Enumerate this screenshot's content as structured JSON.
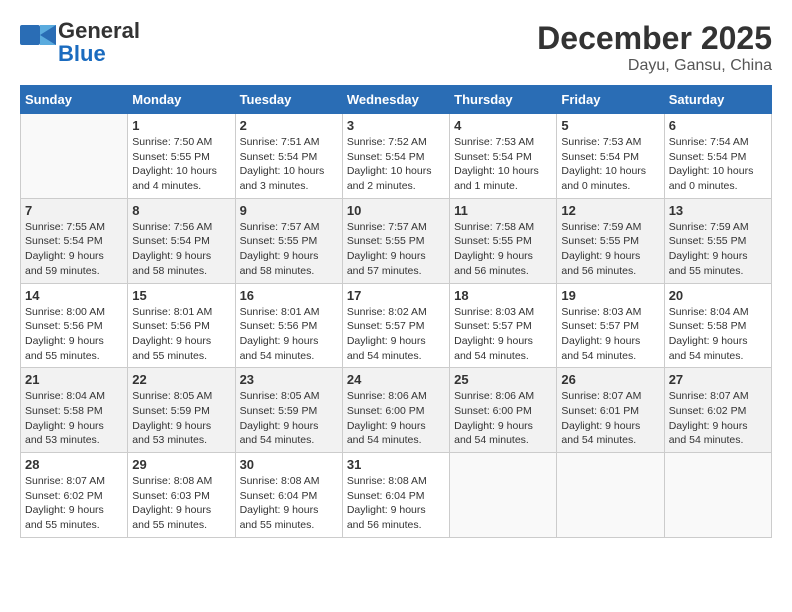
{
  "header": {
    "logo_general": "General",
    "logo_blue": "Blue",
    "month_title": "December 2025",
    "location": "Dayu, Gansu, China"
  },
  "weekdays": [
    "Sunday",
    "Monday",
    "Tuesday",
    "Wednesday",
    "Thursday",
    "Friday",
    "Saturday"
  ],
  "weeks": [
    [
      {
        "empty": true
      },
      {
        "day": "1",
        "sunrise": "7:50 AM",
        "sunset": "5:55 PM",
        "daylight": "10 hours and 4 minutes."
      },
      {
        "day": "2",
        "sunrise": "7:51 AM",
        "sunset": "5:54 PM",
        "daylight": "10 hours and 3 minutes."
      },
      {
        "day": "3",
        "sunrise": "7:52 AM",
        "sunset": "5:54 PM",
        "daylight": "10 hours and 2 minutes."
      },
      {
        "day": "4",
        "sunrise": "7:53 AM",
        "sunset": "5:54 PM",
        "daylight": "10 hours and 1 minute."
      },
      {
        "day": "5",
        "sunrise": "7:53 AM",
        "sunset": "5:54 PM",
        "daylight": "10 hours and 0 minutes."
      },
      {
        "day": "6",
        "sunrise": "7:54 AM",
        "sunset": "5:54 PM",
        "daylight": "10 hours and 0 minutes."
      }
    ],
    [
      {
        "day": "7",
        "sunrise": "7:55 AM",
        "sunset": "5:54 PM",
        "daylight": "9 hours and 59 minutes."
      },
      {
        "day": "8",
        "sunrise": "7:56 AM",
        "sunset": "5:54 PM",
        "daylight": "9 hours and 58 minutes."
      },
      {
        "day": "9",
        "sunrise": "7:57 AM",
        "sunset": "5:55 PM",
        "daylight": "9 hours and 58 minutes."
      },
      {
        "day": "10",
        "sunrise": "7:57 AM",
        "sunset": "5:55 PM",
        "daylight": "9 hours and 57 minutes."
      },
      {
        "day": "11",
        "sunrise": "7:58 AM",
        "sunset": "5:55 PM",
        "daylight": "9 hours and 56 minutes."
      },
      {
        "day": "12",
        "sunrise": "7:59 AM",
        "sunset": "5:55 PM",
        "daylight": "9 hours and 56 minutes."
      },
      {
        "day": "13",
        "sunrise": "7:59 AM",
        "sunset": "5:55 PM",
        "daylight": "9 hours and 55 minutes."
      }
    ],
    [
      {
        "day": "14",
        "sunrise": "8:00 AM",
        "sunset": "5:56 PM",
        "daylight": "9 hours and 55 minutes."
      },
      {
        "day": "15",
        "sunrise": "8:01 AM",
        "sunset": "5:56 PM",
        "daylight": "9 hours and 55 minutes."
      },
      {
        "day": "16",
        "sunrise": "8:01 AM",
        "sunset": "5:56 PM",
        "daylight": "9 hours and 54 minutes."
      },
      {
        "day": "17",
        "sunrise": "8:02 AM",
        "sunset": "5:57 PM",
        "daylight": "9 hours and 54 minutes."
      },
      {
        "day": "18",
        "sunrise": "8:03 AM",
        "sunset": "5:57 PM",
        "daylight": "9 hours and 54 minutes."
      },
      {
        "day": "19",
        "sunrise": "8:03 AM",
        "sunset": "5:57 PM",
        "daylight": "9 hours and 54 minutes."
      },
      {
        "day": "20",
        "sunrise": "8:04 AM",
        "sunset": "5:58 PM",
        "daylight": "9 hours and 54 minutes."
      }
    ],
    [
      {
        "day": "21",
        "sunrise": "8:04 AM",
        "sunset": "5:58 PM",
        "daylight": "9 hours and 53 minutes."
      },
      {
        "day": "22",
        "sunrise": "8:05 AM",
        "sunset": "5:59 PM",
        "daylight": "9 hours and 53 minutes."
      },
      {
        "day": "23",
        "sunrise": "8:05 AM",
        "sunset": "5:59 PM",
        "daylight": "9 hours and 54 minutes."
      },
      {
        "day": "24",
        "sunrise": "8:06 AM",
        "sunset": "6:00 PM",
        "daylight": "9 hours and 54 minutes."
      },
      {
        "day": "25",
        "sunrise": "8:06 AM",
        "sunset": "6:00 PM",
        "daylight": "9 hours and 54 minutes."
      },
      {
        "day": "26",
        "sunrise": "8:07 AM",
        "sunset": "6:01 PM",
        "daylight": "9 hours and 54 minutes."
      },
      {
        "day": "27",
        "sunrise": "8:07 AM",
        "sunset": "6:02 PM",
        "daylight": "9 hours and 54 minutes."
      }
    ],
    [
      {
        "day": "28",
        "sunrise": "8:07 AM",
        "sunset": "6:02 PM",
        "daylight": "9 hours and 55 minutes."
      },
      {
        "day": "29",
        "sunrise": "8:08 AM",
        "sunset": "6:03 PM",
        "daylight": "9 hours and 55 minutes."
      },
      {
        "day": "30",
        "sunrise": "8:08 AM",
        "sunset": "6:04 PM",
        "daylight": "9 hours and 55 minutes."
      },
      {
        "day": "31",
        "sunrise": "8:08 AM",
        "sunset": "6:04 PM",
        "daylight": "9 hours and 56 minutes."
      },
      {
        "empty": true
      },
      {
        "empty": true
      },
      {
        "empty": true
      }
    ]
  ],
  "labels": {
    "sunrise_prefix": "Sunrise: ",
    "sunset_prefix": "Sunset: ",
    "daylight_prefix": "Daylight: "
  }
}
